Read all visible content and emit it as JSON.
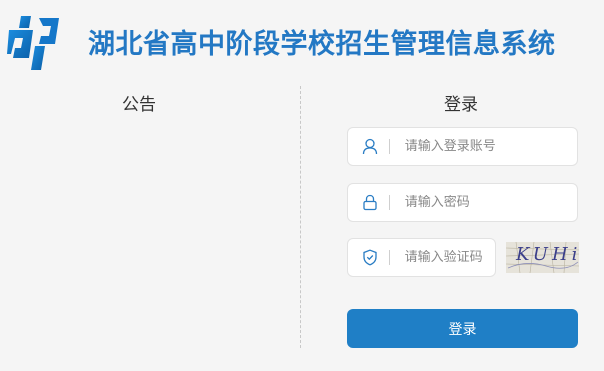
{
  "header": {
    "title": "湖北省高中阶段学校招生管理信息系统",
    "brand_color": "#2378c4"
  },
  "notice": {
    "title": "公告"
  },
  "login": {
    "title": "登录",
    "username_placeholder": "请输入登录账号",
    "password_placeholder": "请输入密码",
    "captcha_placeholder": "请输入验证码",
    "captcha_text": "KUHi",
    "submit_label": "登录",
    "button_color": "#1f7fc6"
  },
  "icons": {
    "logo": "app-logo",
    "username": "user-icon",
    "password": "lock-icon",
    "captcha": "shield-check-icon"
  }
}
